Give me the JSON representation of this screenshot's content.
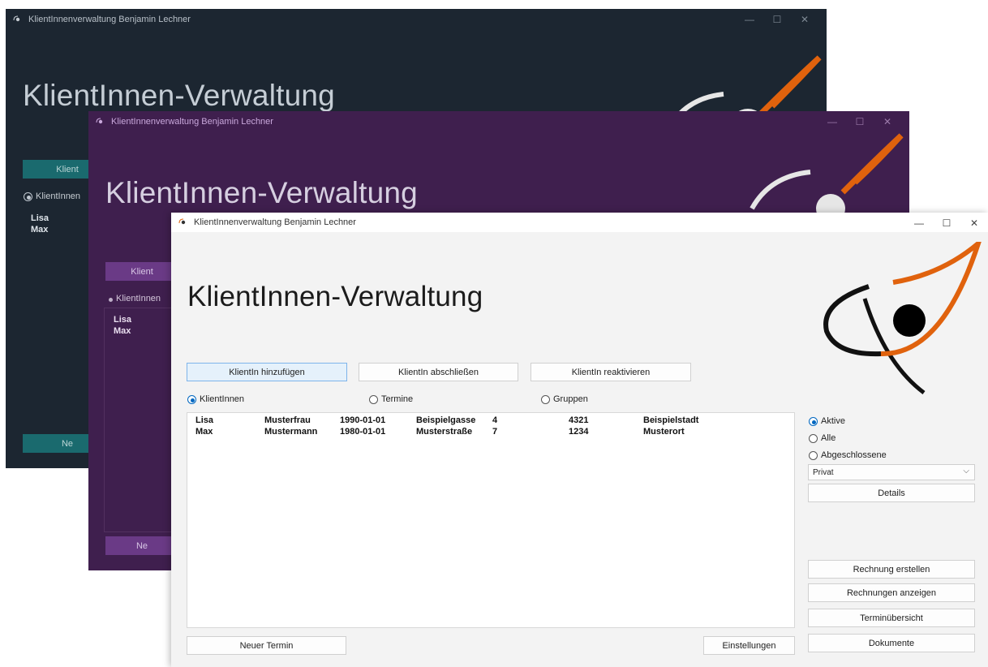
{
  "window_title": "KlientInnenverwaltung Benjamin Lechner",
  "app_title": "KlientInnen-Verwaltung",
  "controls": {
    "minimize": "—",
    "maximize": "☐",
    "close": "✕"
  },
  "buttons": {
    "add_client": "KlientIn hinzufügen",
    "close_client": "KlientIn abschließen",
    "reactivate_client": "KlientIn reaktivieren",
    "new_appointment": "Neuer Termin",
    "settings": "Einstellungen",
    "details": "Details",
    "create_invoice": "Rechnung erstellen",
    "show_invoices": "Rechnungen anzeigen",
    "appointment_overview": "Terminübersicht",
    "documents": "Dokumente"
  },
  "partial_labels": {
    "add_client_dark": "Klient",
    "add_client_purple": "Klient",
    "new_dark": "Ne",
    "new_purple": "Ne"
  },
  "view_tabs": {
    "clients": "KlientInnen",
    "appointments": "Termine",
    "groups": "Gruppen",
    "selected": "clients"
  },
  "filter": {
    "active": "Aktive",
    "all": "Alle",
    "closed": "Abgeschlossene",
    "selected": "active"
  },
  "insurance_select": {
    "value": "Privat"
  },
  "clients": [
    {
      "first": "Lisa",
      "last": "Musterfrau",
      "birth": "1990-01-01",
      "street": "Beispielgasse",
      "number": "4",
      "zip": "4321",
      "city": "Beispielstadt"
    },
    {
      "first": "Max",
      "last": "Mustermann",
      "birth": "1980-01-01",
      "street": "Musterstraße",
      "number": "7",
      "zip": "1234",
      "city": "Musterort"
    }
  ],
  "themes": {
    "dark_bg": "#1c2631",
    "purple_bg": "#3f1f4e",
    "light_bg": "#f3f3f3",
    "accent_orange": "#e0620d",
    "accent_blue": "#0067c0"
  }
}
